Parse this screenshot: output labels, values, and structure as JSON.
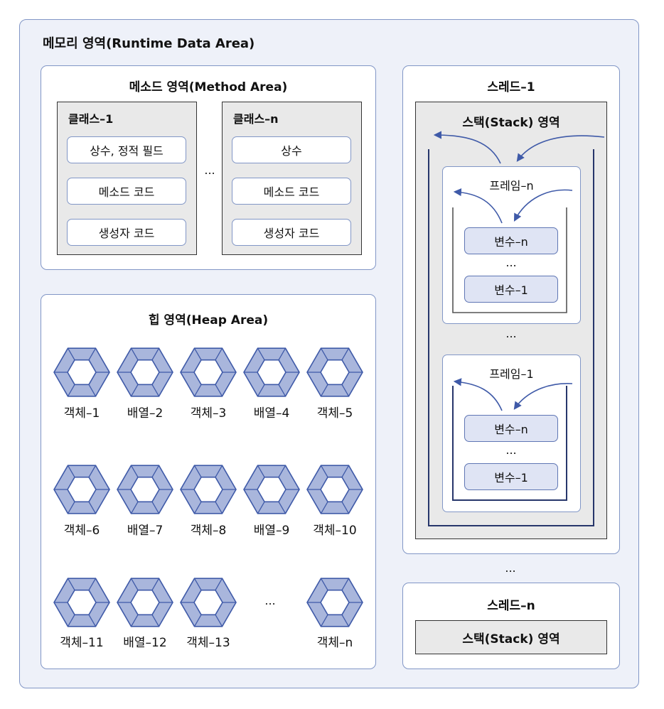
{
  "runtime_title": "메모리 영역(Runtime Data Area)",
  "method_area": {
    "title": "메소드 영역(Method Area)",
    "class_1": {
      "title": "클래스–1",
      "items": [
        "상수, 정적 필드",
        "메소드 코드",
        "생성자 코드"
      ]
    },
    "class_n": {
      "title": "클래스–n",
      "items": [
        "상수",
        "메소드 코드",
        "생성자 코드"
      ]
    },
    "ellipsis": "..."
  },
  "heap_area": {
    "title": "힙 영역(Heap Area)",
    "objects": [
      "객체–1",
      "배열–2",
      "객체–3",
      "배열–4",
      "객체–5",
      "객체–6",
      "배열–7",
      "객체–8",
      "배열–9",
      "객체–10",
      "객체–11",
      "배열–12",
      "객체–13",
      "객체–n"
    ],
    "ellipsis": "..."
  },
  "thread_1": {
    "title": "스레드–1",
    "stack_title": "스택(Stack) 영역",
    "frame_n": {
      "title": "프레임–n",
      "vars": [
        "변수–n",
        "변수–1"
      ],
      "ellipsis": "..."
    },
    "frame_1": {
      "title": "프레임–1",
      "vars": [
        "변수–n",
        "변수–1"
      ],
      "ellipsis": "..."
    },
    "frames_ellipsis": "..."
  },
  "threads_ellipsis": "...",
  "thread_n": {
    "title": "스레드–n",
    "stack_title": "스택(Stack) 영역"
  },
  "colors": {
    "accent": "#8196c6",
    "arrow": "#3f5aa8",
    "hex_fill": "#a9b6dc",
    "hex_stroke": "#3f5aa8",
    "panel_bg": "#eef1f9",
    "gray": "#e9e9e9"
  }
}
